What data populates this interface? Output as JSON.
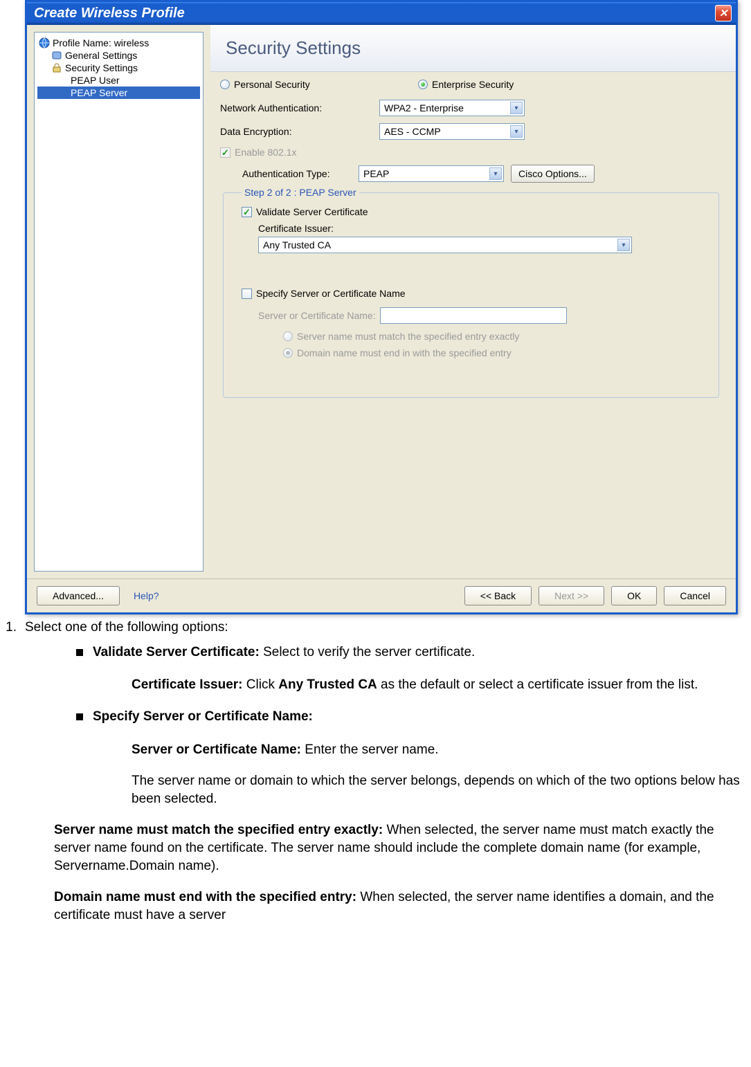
{
  "window": {
    "title": "Create Wireless Profile"
  },
  "tree": {
    "profile": "Profile Name: wireless",
    "general": "General Settings",
    "security": "Security Settings",
    "peap_user": "PEAP User",
    "peap_server": "PEAP Server"
  },
  "header": {
    "title": "Security Settings"
  },
  "radios": {
    "personal": "Personal Security",
    "enterprise": "Enterprise Security"
  },
  "net_auth": {
    "label": "Network Authentication:",
    "value": "WPA2 - Enterprise"
  },
  "data_enc": {
    "label": "Data Encryption:",
    "value": "AES - CCMP"
  },
  "enable_8021x": "Enable 802.1x",
  "auth_type": {
    "label": "Authentication Type:",
    "value": "PEAP"
  },
  "cisco_btn": "Cisco Options...",
  "step": {
    "legend": "Step 2 of 2 : PEAP Server",
    "validate": "Validate Server Certificate",
    "cert_issuer_label": "Certificate Issuer:",
    "cert_issuer_value": "Any Trusted CA",
    "specify_name": "Specify Server or Certificate Name",
    "server_name_label": "Server or Certificate Name:",
    "opt_exact": "Server name must match the specified entry exactly",
    "opt_domain": "Domain name must end in with the specified entry"
  },
  "footer": {
    "advanced": "Advanced...",
    "help": "Help?",
    "back": "<< Back",
    "next": "Next >>",
    "ok": "OK",
    "cancel": "Cancel"
  },
  "instr": {
    "num": "1.",
    "lead": "Select one of the following options:",
    "b1_strong": "Validate Server Certificate:",
    "b1_rest": " Select to verify the server certificate.",
    "b1_sub_strong": "Certificate Issuer:",
    "b1_sub_rest_a": " Click ",
    "b1_sub_strong2": "Any Trusted CA",
    "b1_sub_rest_b": " as the default or select a certificate issuer from the list.",
    "b2_strong": "Specify Server or Certificate Name:",
    "b2_sub_strong": "Server or Certificate Name:",
    "b2_sub_rest": " Enter the server name.",
    "b2_para": "The server name or domain to which the server belongs, depends on which of the two options below has been selected.",
    "p3_strong": "Server name must match the specified entry exactly:",
    "p3_rest": " When selected, the server name must match exactly the server name found on the certificate. The server name should include the complete domain name (for example, Servername.Domain name).",
    "p4_strong": "Domain name must end with the specified entry:",
    "p4_rest": " When selected, the server name identifies a domain, and the certificate must have a server"
  }
}
